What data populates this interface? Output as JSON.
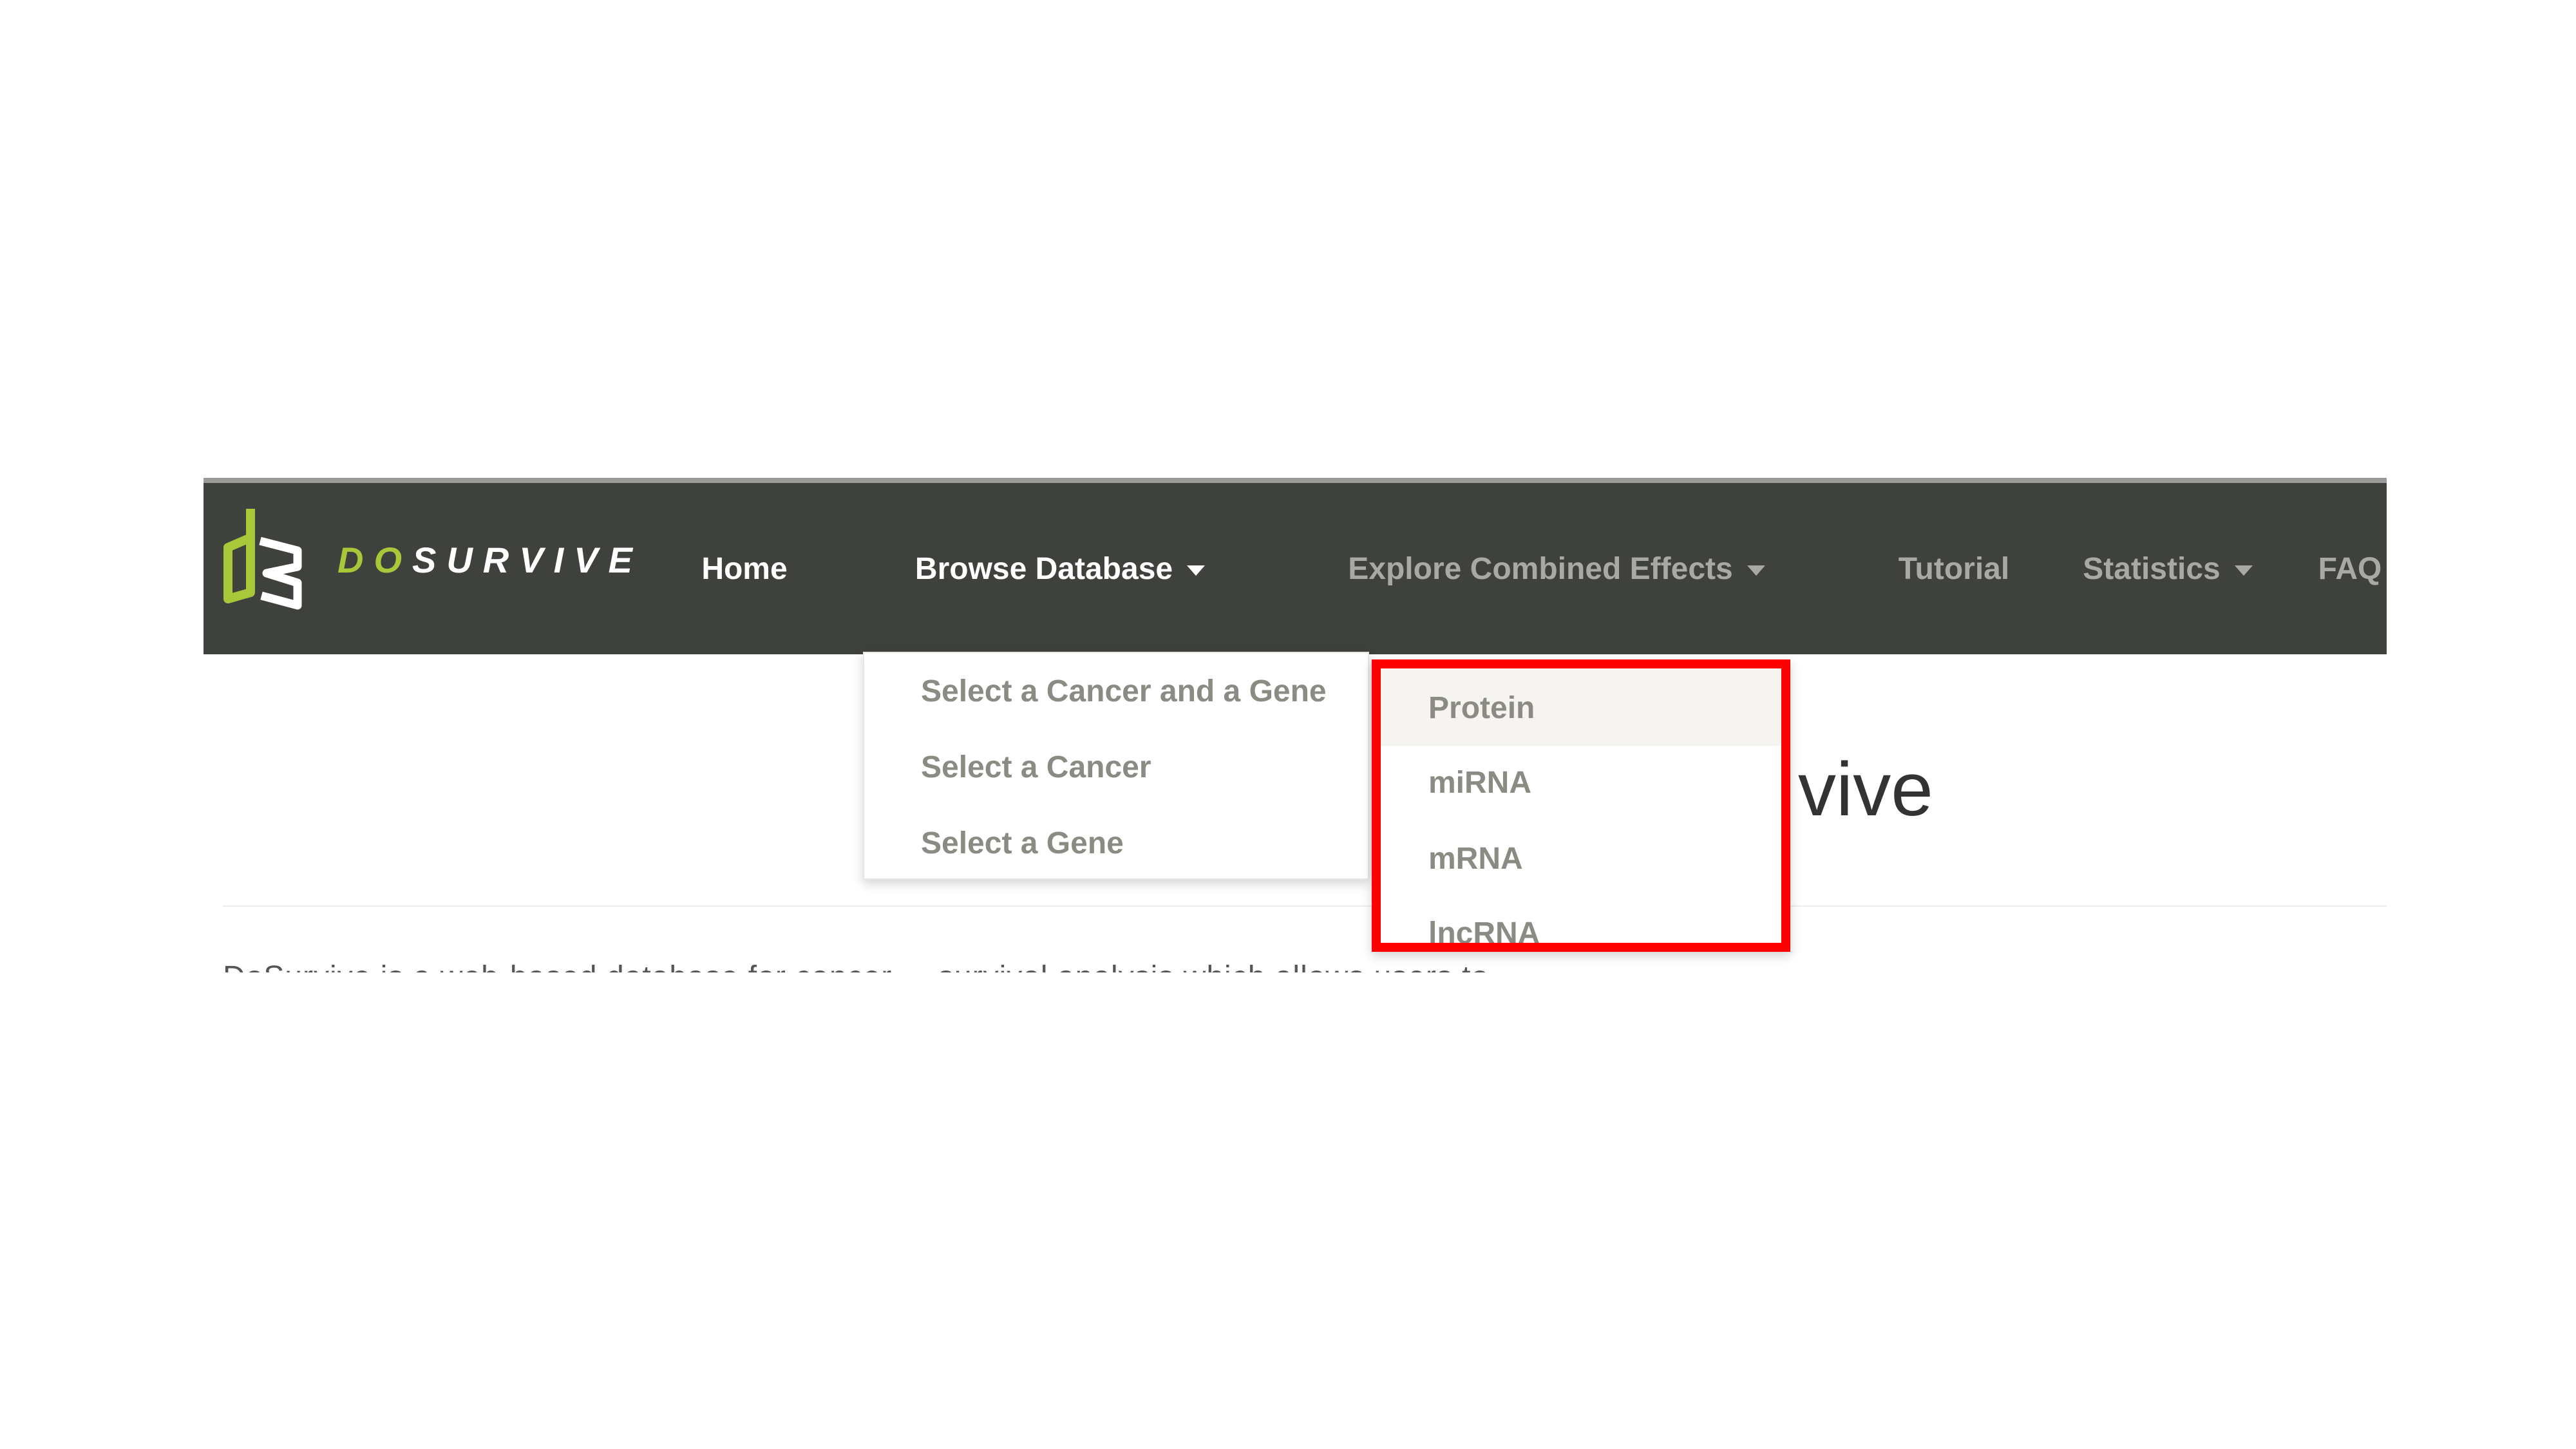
{
  "brand": {
    "prefix": "DO",
    "name": "SURVIVE",
    "accent_color": "#a8c83a",
    "logo": "ds-logo-icon"
  },
  "navbar": {
    "background": "#3f423c",
    "items": [
      {
        "label": "Home"
      },
      {
        "label": "Browse Database",
        "has_dropdown": true
      },
      {
        "label": "Explore Combined Effects",
        "has_dropdown": true
      },
      {
        "label": "Tutorial"
      },
      {
        "label": "Statistics",
        "has_dropdown": true
      },
      {
        "label": "FAQ"
      }
    ]
  },
  "browse_menu": {
    "items": [
      {
        "label": "Select a Cancer and a Gene"
      },
      {
        "label": "Select a Cancer"
      },
      {
        "label": "Select a Gene"
      }
    ]
  },
  "submenu": {
    "items": [
      {
        "label": "Protein",
        "hovered": true
      },
      {
        "label": "miRNA"
      },
      {
        "label": "mRNA"
      },
      {
        "label": "lncRNA"
      }
    ]
  },
  "page": {
    "title_visible": "vive",
    "intro_text_visible": "DoSurvive is a web-based database for cancer ... survival analysis which allows users to"
  },
  "annotation": {
    "highlight_color": "#ff0000"
  }
}
